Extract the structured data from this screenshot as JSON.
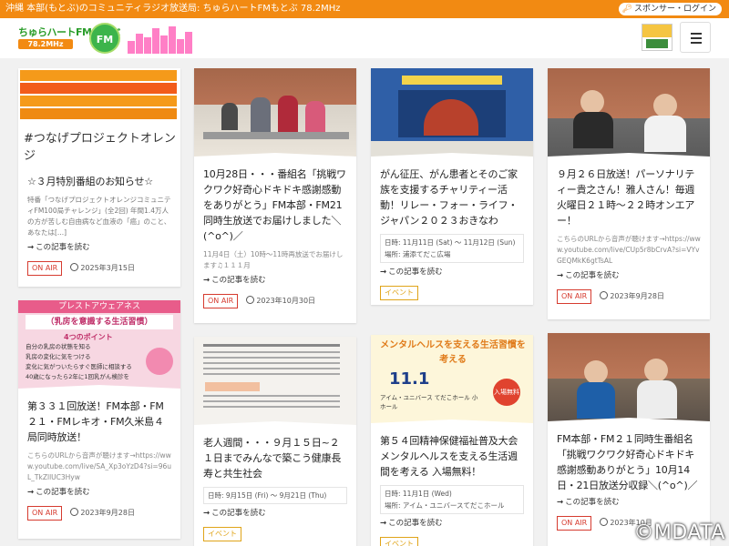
{
  "topbar": {
    "tagline": "沖縄 本部(もとぶ)のコミュニティラジオ放送局: ちゅらハートFMもとぶ 78.2MHz",
    "sponsor_login": "スポンサー・ログイン"
  },
  "header": {
    "logo_text": "ちゅらハートFMもとぶ",
    "logo_freq": "78.2MHz",
    "logo_mark": "FM"
  },
  "more_label": "この記事を読む",
  "cards": [
    {
      "title": "☆３月特別番組のお知らせ☆",
      "excerpt": "特番「つなげプロジェクトオレンジコミュニティFM100局チャレンジ」(全2回) 年間1.4万人の方が苦しむ自由病など血液の「癌」のこと、あなたは[...]",
      "badge": "ON AIR",
      "date": "2025年3月15日",
      "image_caption": "#つなげプロジェクトオレンジ"
    },
    {
      "title": "10月28日・・・番組名「挑戦ワクワク好奇心ドキドキ感謝感動をありがとう」FM本部・FM21同時生放送でお届けしました＼(^o^)／",
      "excerpt": "11月4日（土）10時〜11時再放送でお届けします♫１１１月",
      "badge": "ON AIR",
      "date": "2023年10月30日"
    },
    {
      "title": "がん征圧、がん患者とそのご家族を支援するチャリティー活動！リレー・フォー・ライフ・ジャパン２０２３おきなわ",
      "event_date": "日時: 11月11日 (Sat) 〜 11月12日 (Sun)",
      "event_place": "場所: 浦添てだこ広場",
      "badge": "イベント"
    },
    {
      "title": "９月２６日放送！パーソナリティー貴之さん！雅人さん！毎週火曜日２１時〜２２時オンエアー！",
      "excerpt": "こちらのURLから音声が聴けます→https://www.youtube.com/live/CUp5r8bCrvA?si=VYvGEQMkK6gtTsAL",
      "badge": "ON AIR",
      "date": "2023年9月28日"
    },
    {
      "title": "第３３１回放送！FM本部・FM２１・FMレキオ・FM久米島４局同時放送！",
      "excerpt": "こちらのURLから音声が聴けます→https://www.youtube.com/live/SA_Xp3oYzD4?si=96uL_TkZllUC3Hyw",
      "badge": "ON AIR",
      "date": "2023年9月28日",
      "image_caption": "（乳房を意識する生活習慣）",
      "image_heading": "プレストアウェアネス",
      "image_points": "4つのポイント",
      "image_items": [
        "自分の乳房の状態を知る",
        "乳房の変化に気をつける",
        "変化に気がついたらすぐ医師に相談する",
        "40歳になったら2年に1回乳がん検診を"
      ]
    },
    {
      "title": "老人週間・・・９月１５日~２１日までみんなで築こう健康長寿と共生社会",
      "event_date": "日時: 9月15日 (Fri) 〜 9月21日 (Thu)",
      "badge": "イベント"
    },
    {
      "title": "第５４回精神保健福祉普及大会メンタルヘルスを支える生活週間を考える 入場無料！",
      "event_date": "日時: 11月1日 (Wed)",
      "event_place": "場所: アイム・ユニバースてだこホール",
      "badge": "イベント",
      "image_caption": "メンタルヘルスを支える生活習慣を考える",
      "image_date": "11.1",
      "image_venue": "アイム・ユニバース てだこホール 小ホール",
      "image_free": "入場無料"
    },
    {
      "title": "FM本部・FM２１同時生番組名「挑戦ワクワク好奇心ドキドキ感謝感動ありがとう」10月14日・21日放送分収録＼(^o^)／",
      "badge": "ON AIR",
      "date": "2023年10月"
    }
  ],
  "watermark": "©MDATA",
  "colors": {
    "brand_orange": "#f28a12",
    "onair_red": "#d63b2f",
    "event_yellow": "#e0a419"
  }
}
